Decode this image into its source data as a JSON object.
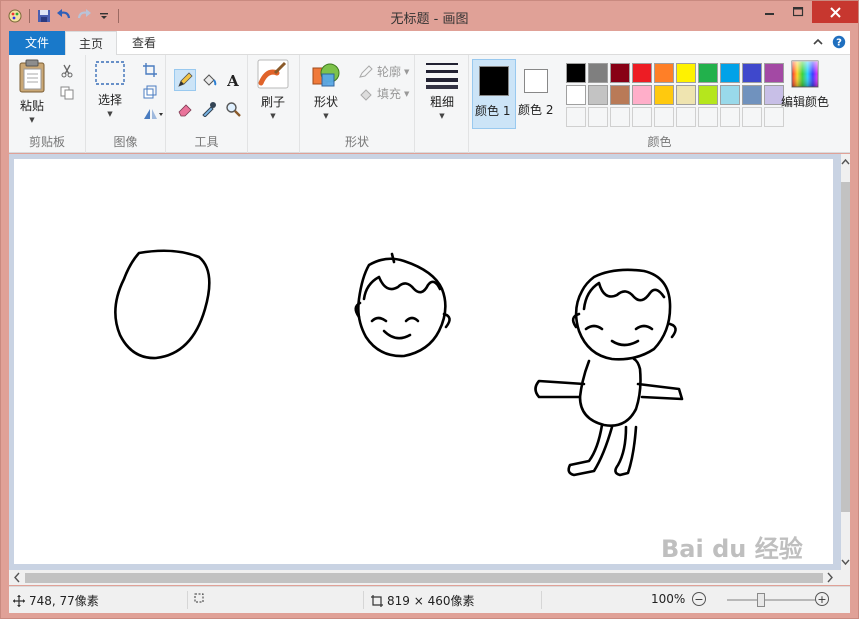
{
  "window": {
    "title": "无标题 - 画图"
  },
  "tabs": {
    "file": "文件",
    "home": "主页",
    "view": "查看"
  },
  "ribbon": {
    "clipboard": {
      "label": "剪贴板",
      "paste": "粘贴"
    },
    "image": {
      "label": "图像",
      "select": "选择"
    },
    "tools": {
      "label": "工具"
    },
    "brushes": {
      "label": "刷子"
    },
    "shapes": {
      "label": "形状",
      "shapes": "形状",
      "outline": "轮廓",
      "fill": "填充"
    },
    "size": {
      "label": "粗细"
    },
    "colors": {
      "label": "颜色",
      "color1": "颜色 1",
      "color2": "颜色 2",
      "edit": "编辑颜色",
      "color1_value": "#000000",
      "color2_value": "#ffffff",
      "palette_row1": [
        "#000000",
        "#7f7f7f",
        "#880015",
        "#ed1c24",
        "#ff7f27",
        "#fff200",
        "#22b14c",
        "#00a2e8",
        "#3f48cc",
        "#a349a4"
      ],
      "palette_row2": [
        "#ffffff",
        "#c3c3c3",
        "#b97a57",
        "#ffaec9",
        "#ffc90e",
        "#efe4b0",
        "#b5e61d",
        "#99d9ea",
        "#7092be",
        "#c8bfe7"
      ]
    }
  },
  "status": {
    "cursor_pos": "748, 77像素",
    "canvas_size": "819 × 460像素",
    "zoom": "100%",
    "zoom_minus": "−",
    "zoom_plus": "+"
  },
  "watermark": "Bai du 经验"
}
